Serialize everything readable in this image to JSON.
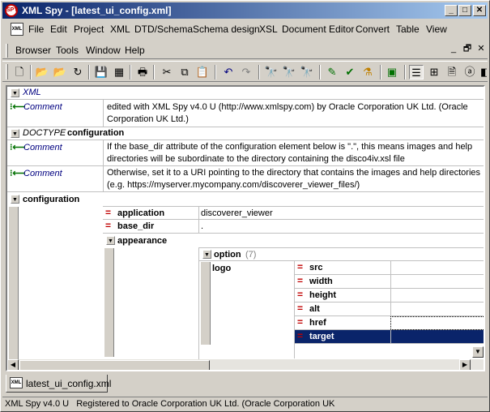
{
  "window": {
    "title": "XML Spy - [latest_ui_config.xml]",
    "app_icon_text": "SPY",
    "buttons": {
      "minimize": "_",
      "maximize": "□",
      "close": "✕"
    }
  },
  "menu_row1": {
    "doc_icon_text": "XML",
    "items": [
      "File",
      "Edit",
      "Project",
      "XML",
      "DTD/Schema",
      "Schema design",
      "XSL",
      "Document Editor",
      "Convert",
      "Table",
      "View"
    ]
  },
  "menu_row2": {
    "items": [
      "Browser",
      "Tools",
      "Window",
      "Help"
    ],
    "mdi": {
      "minimize": "_",
      "restore": "🗗",
      "close": "✕"
    }
  },
  "toolbar": {
    "icons": [
      "new-icon",
      "open-icon",
      "open-url-icon",
      "reload-icon",
      "save-icon",
      "save-all-icon",
      "print-icon",
      "cut-icon",
      "copy-icon",
      "paste-icon",
      "undo-icon",
      "redo-icon",
      "find-icon",
      "find-next-icon",
      "replace-icon",
      "check-wellformed-icon",
      "validate-icon",
      "dtd-icon",
      "xsl-transform-icon",
      "grid-view-icon",
      "schema-view-icon",
      "text-view-icon",
      "document-view-icon",
      "browser-view-icon"
    ]
  },
  "grid": {
    "xml_label": "XML",
    "comment_label": "Comment",
    "comment1": "edited with XML Spy v4.0 U (http://www.xmlspy.com) by Oracle Corporation UK Ltd. (Oracle Corporation UK Ltd.)",
    "doctype_label": "DOCTYPE",
    "doctype_name": "configuration",
    "comment2": "If the base_dir attribute of the configuration element below is \".\", this means images and help directories will be subordinate to the directory containing the disco4iv.xsl file",
    "comment3": "Otherwise, set it to a URI pointing to the directory that contains the images and help directories (e.g. https://myserver.mycompany.com/discoverer_viewer_files/)",
    "root": "configuration",
    "attr_application": "application",
    "attr_application_value": "discoverer_viewer",
    "attr_base_dir": "base_dir",
    "attr_base_dir_value": ".",
    "appearance": "appearance",
    "option": "option",
    "option_count": "(7)",
    "logo": "logo",
    "logo_attrs": [
      "src",
      "width",
      "height",
      "alt",
      "href",
      "target"
    ],
    "selected_attr": "target"
  },
  "tabs": {
    "file": "latest_ui_config.xml"
  },
  "status": {
    "text": "XML Spy v4.0 U   Registered to Oracle Corporation UK Ltd. (Oracle Corporation UK"
  },
  "colors": {
    "title_start": "#0a246a",
    "title_end": "#a6caf0",
    "selection": "#0a246a",
    "attr_marker": "#c00000",
    "comment_icon": "#007000"
  }
}
